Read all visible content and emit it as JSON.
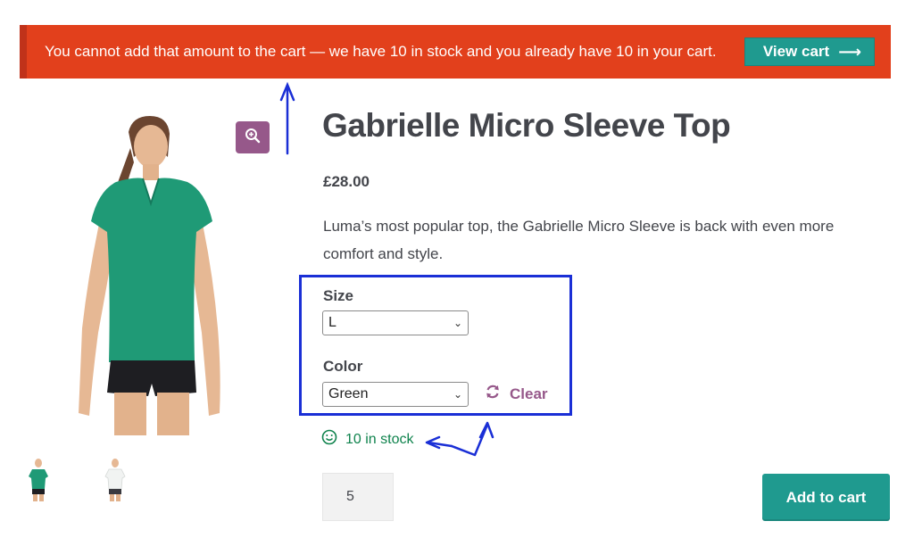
{
  "notice": {
    "message": "You cannot add that amount to the cart — we have 10 in stock and you already have 10 in your cart.",
    "view_cart_label": "View cart",
    "view_cart_icon": "arrow-right-icon",
    "background_color": "#e2401c"
  },
  "gallery": {
    "zoom_icon": "magnifier-plus-icon",
    "thumbnails": [
      "green-top-model",
      "white-top-model"
    ]
  },
  "product": {
    "title": "Gabrielle Micro Sleeve Top",
    "price": "£28.00",
    "description": "Luma’s most popular top, the Gabrielle Micro Sleeve is back with even more comfort and style.",
    "variations": {
      "size_label": "Size",
      "size_value": "L",
      "color_label": "Color",
      "color_value": "Green",
      "clear_label": "Clear",
      "clear_icon": "refresh-icon"
    },
    "stock": {
      "text": "10 in stock",
      "icon": "smiley-icon",
      "color": "#0f834d"
    },
    "quantity": "5",
    "add_to_cart_label": "Add to cart",
    "accent_color": "#1f9a8f",
    "secondary_color": "#96588a"
  }
}
